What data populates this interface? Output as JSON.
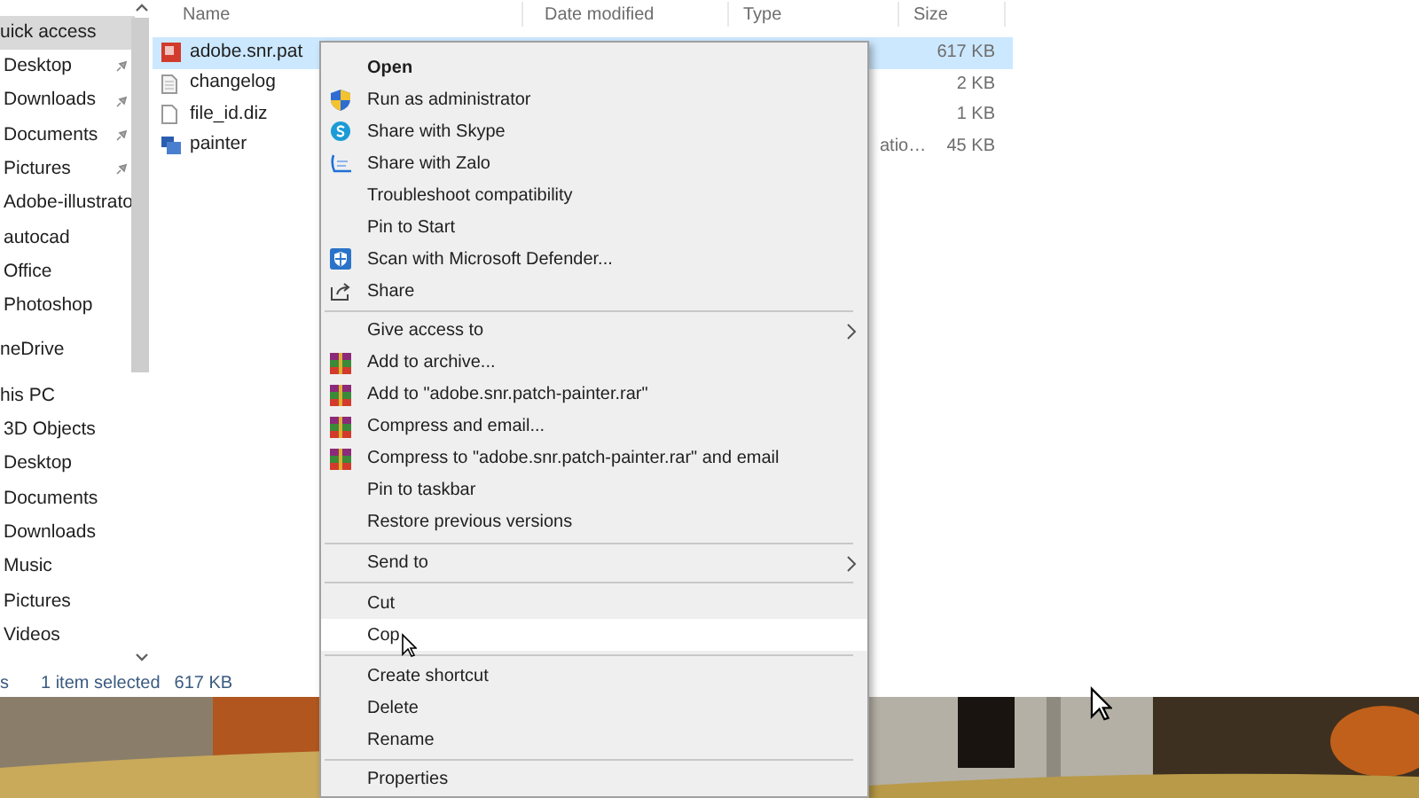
{
  "navigation_pane": {
    "items": [
      {
        "label": "uick access",
        "selected": true,
        "children": [
          {
            "label": "Desktop",
            "pinned": true,
            "selected": false
          },
          {
            "label": "Downloads",
            "pinned": true,
            "selected": false
          },
          {
            "label": "Documents",
            "pinned": true,
            "selected": false
          },
          {
            "label": "Pictures",
            "pinned": true,
            "selected": false
          },
          {
            "label": "Adobe-illustrato",
            "pinned": false,
            "selected": false
          },
          {
            "label": "autocad",
            "pinned": false,
            "selected": false
          },
          {
            "label": "Office",
            "pinned": false,
            "selected": false
          },
          {
            "label": "Photoshop",
            "pinned": false,
            "selected": false
          }
        ]
      },
      {
        "label": "neDrive",
        "selected": false
      },
      {
        "label": "his PC",
        "selected": false,
        "children": [
          {
            "label": "3D Objects",
            "pinned": false,
            "selected": false
          },
          {
            "label": "Desktop",
            "pinned": false,
            "selected": false
          },
          {
            "label": "Documents",
            "pinned": false,
            "selected": false
          },
          {
            "label": "Downloads",
            "pinned": false,
            "selected": false
          },
          {
            "label": "Music",
            "pinned": false,
            "selected": false
          },
          {
            "label": "Pictures",
            "pinned": false,
            "selected": false
          },
          {
            "label": "Videos",
            "pinned": false,
            "selected": false
          }
        ]
      }
    ]
  },
  "file_list": {
    "columns": [
      "Name",
      "Date modified",
      "Type",
      "Size"
    ],
    "rows": [
      {
        "name": "adobe.snr.pat",
        "kind": "app",
        "size": "617 KB",
        "selected": true
      },
      {
        "name": "changelog",
        "kind": "text",
        "size": "2 KB",
        "selected": false
      },
      {
        "name": "file_id.diz",
        "kind": "file",
        "size": "1 KB",
        "selected": false
      },
      {
        "name": "painter",
        "kind": "program",
        "type": "atio…",
        "size": "45 KB",
        "selected": false
      }
    ]
  },
  "status_bar": {
    "item_count": "s",
    "selection": "1 item selected",
    "size": "617 KB"
  },
  "context_menu": {
    "items": [
      {
        "kind": "item",
        "label": "Open",
        "bold": true,
        "selected": false
      },
      {
        "kind": "admin",
        "label": "Run as administrator",
        "selected": false
      },
      {
        "kind": "skype",
        "label": "Share with Skype",
        "selected": false
      },
      {
        "kind": "chat",
        "label": "Share with Zalo",
        "selected": false
      },
      {
        "kind": "item",
        "label": "Troubleshoot compatibility",
        "selected": false
      },
      {
        "kind": "item",
        "label": "Pin to Start",
        "selected": false
      },
      {
        "kind": "scan",
        "label": "Scan with Microsoft Defender...",
        "selected": false
      },
      {
        "kind": "share",
        "label": "Share",
        "selected": false
      },
      {
        "kind": "separator"
      },
      {
        "kind": "item",
        "label": "Give access to",
        "submenu": true,
        "selected": false
      },
      {
        "kind": "archive",
        "label": "Add to archive...",
        "selected": false
      },
      {
        "kind": "archive",
        "label": "Add to \"adobe.snr.patch-painter.rar\"",
        "selected": false
      },
      {
        "kind": "archive",
        "label": "Compress and email...",
        "selected": false
      },
      {
        "kind": "archive",
        "label": "Compress to \"adobe.snr.patch-painter.rar\" and email",
        "selected": false
      },
      {
        "kind": "item",
        "label": "Pin to taskbar",
        "selected": false
      },
      {
        "kind": "item",
        "label": "Restore previous versions",
        "selected": false
      },
      {
        "kind": "separator"
      },
      {
        "kind": "item",
        "label": "Send to",
        "submenu": true,
        "selected": false
      },
      {
        "kind": "separator"
      },
      {
        "kind": "item",
        "label": "Cut",
        "selected": false
      },
      {
        "kind": "item",
        "label": "Cop",
        "selected": true
      },
      {
        "kind": "separator"
      },
      {
        "kind": "item",
        "label": "Create shortcut",
        "selected": false
      },
      {
        "kind": "item",
        "label": "Delete",
        "selected": false
      },
      {
        "kind": "item",
        "label": "Rename",
        "selected": false
      },
      {
        "kind": "separator"
      },
      {
        "kind": "item",
        "label": "Properties",
        "selected": false
      }
    ]
  }
}
